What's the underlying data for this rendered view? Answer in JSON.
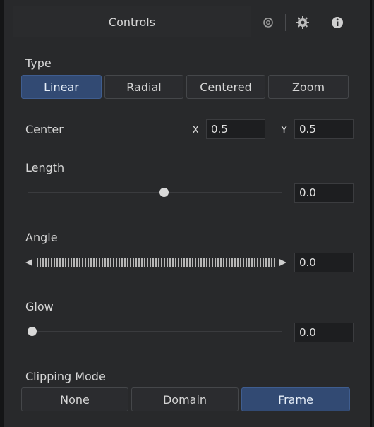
{
  "tabs": {
    "main_label": "Controls",
    "icons": [
      "node-icon",
      "gear-icon",
      "info-icon"
    ]
  },
  "type": {
    "label": "Type",
    "options": [
      "Linear",
      "Radial",
      "Centered",
      "Zoom"
    ],
    "selected": "Linear"
  },
  "center": {
    "label": "Center",
    "x_label": "X",
    "x_value": "0.5",
    "y_label": "Y",
    "y_value": "0.5"
  },
  "length": {
    "label": "Length",
    "value": "0.0",
    "slider_fraction": 0.52
  },
  "angle": {
    "label": "Angle",
    "value": "0.0"
  },
  "glow": {
    "label": "Glow",
    "value": "0.0",
    "slider_fraction": 0.0
  },
  "clipping": {
    "label": "Clipping Mode",
    "options": [
      "None",
      "Domain",
      "Frame"
    ],
    "selected": "Frame"
  },
  "colors": {
    "accent": "#324a73",
    "background": "#28292b",
    "field": "#1d1e20"
  }
}
